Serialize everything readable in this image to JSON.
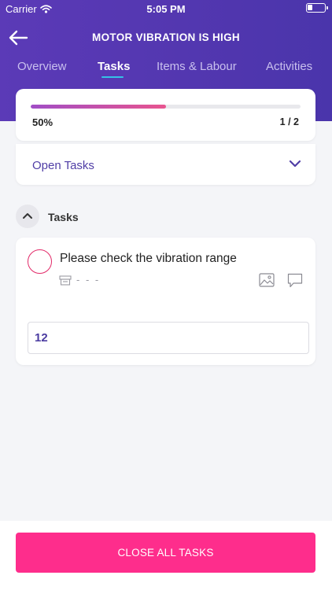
{
  "status_bar": {
    "carrier": "Carrier",
    "time": "5:05 PM"
  },
  "header": {
    "title": "MOTOR VIBRATION IS HIGH",
    "tabs": [
      {
        "label": "Overview",
        "active": false
      },
      {
        "label": "Tasks",
        "active": true
      },
      {
        "label": "Items & Labour",
        "active": false
      },
      {
        "label": "Activities",
        "active": false
      }
    ]
  },
  "progress": {
    "percent_label": "50%",
    "fraction": 0.5,
    "count_label": "1 / 2"
  },
  "filter": {
    "label": "Open Tasks"
  },
  "section": {
    "title": "Tasks"
  },
  "task": {
    "title": "Please check the vibration range",
    "meta": "- - -",
    "input_value": "12"
  },
  "footer": {
    "close_label": "CLOSE ALL TASKS"
  },
  "colors": {
    "header_bg": "#5337b0",
    "tab_indicator": "#35c2e6",
    "accent_text": "#503ea6",
    "progress_start": "#a14ec6",
    "progress_end": "#e8548f",
    "task_check": "#e22968",
    "primary_button": "#fe2d8c"
  },
  "icons": [
    "back-arrow-icon",
    "wifi-icon",
    "battery-icon",
    "chevron-down-icon",
    "chevron-up-icon",
    "tag-icon",
    "image-icon",
    "comment-icon"
  ]
}
